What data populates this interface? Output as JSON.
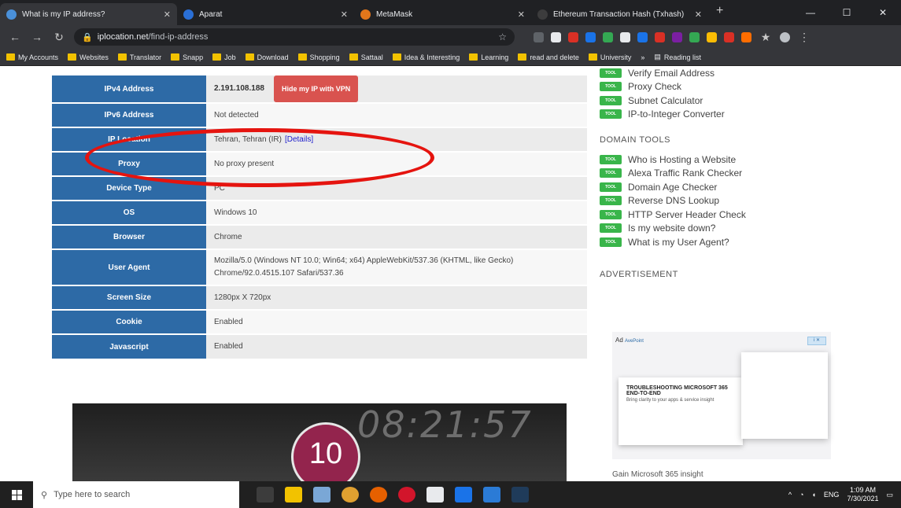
{
  "browser": {
    "tabs": [
      {
        "title": "What is my IP address?",
        "color": "#4a90d9",
        "active": true
      },
      {
        "title": "Aparat",
        "color": "#2a6fd6",
        "active": false
      },
      {
        "title": "MetaMask",
        "color": "#e2761b",
        "active": false
      },
      {
        "title": "Ethereum Transaction Hash (Txhash)",
        "color": "#3c3c3d",
        "active": false
      }
    ],
    "new_tab": "+",
    "window_controls": {
      "minimize": "—",
      "maximize": "☐",
      "close": "✕"
    },
    "address": {
      "host": "iplocation.net",
      "path": "/find-ip-address"
    },
    "bookmarks": [
      "My Accounts",
      "Websites",
      "Translator",
      "Snapp",
      "Job",
      "Download",
      "Shopping",
      "Sattaal",
      "Idea & Interesting",
      "Learning",
      "read and delete",
      "University"
    ],
    "reading_list": "Reading list",
    "more_bookmarks": "»"
  },
  "ip_table": {
    "rows": [
      {
        "label": "IPv4 Address",
        "value": "2.191.108.188",
        "button": "Hide my IP with VPN"
      },
      {
        "label": "IPv6 Address",
        "value": "Not detected"
      },
      {
        "label": "IP Location",
        "value": "Tehran, Tehran (IR)",
        "link": "[Details]"
      },
      {
        "label": "Proxy",
        "value": "No proxy present"
      },
      {
        "label": "Device Type",
        "value": "PC"
      },
      {
        "label": "OS",
        "value": "Windows 10"
      },
      {
        "label": "Browser",
        "value": "Chrome"
      },
      {
        "label": "User Agent",
        "value": "Mozilla/5.0 (Windows NT 10.0; Win64; x64) AppleWebKit/537.36 (KHTML, like Gecko) Chrome/92.0.4515.107 Safari/537.36"
      },
      {
        "label": "Screen Size",
        "value": "1280px X 720px"
      },
      {
        "label": "Cookie",
        "value": "Enabled"
      },
      {
        "label": "Javascript",
        "value": "Enabled"
      }
    ]
  },
  "sidebar": {
    "badge": "TOOL",
    "email_tools": [
      "Verify Email Address",
      "Proxy Check",
      "Subnet Calculator",
      "IP-to-Integer Converter"
    ],
    "domain_heading": "DOMAIN TOOLS",
    "domain_tools": [
      "Who is Hosting a Website",
      "Alexa Traffic Rank Checker",
      "Domain Age Checker",
      "Reverse DNS Lookup",
      "HTTP Server Header Check",
      "Is my website down?",
      "What is my User Agent?"
    ],
    "ad_heading": "ADVERTISEMENT"
  },
  "ad": {
    "label": "Ad",
    "brand": "AvePoint",
    "corner": "i ✕",
    "headline": "TROUBLESHOOTING MICROSOFT 365 END-TO-END",
    "subline": "Bring clarity to your apps & service insight",
    "caption": "Gain Microsoft 365 insight"
  },
  "video": {
    "clock": "08:21:57",
    "number": "10"
  },
  "taskbar": {
    "search_placeholder": "Type here to search",
    "language": "ENG",
    "time": "1:09 AM",
    "date": "7/30/2021"
  }
}
